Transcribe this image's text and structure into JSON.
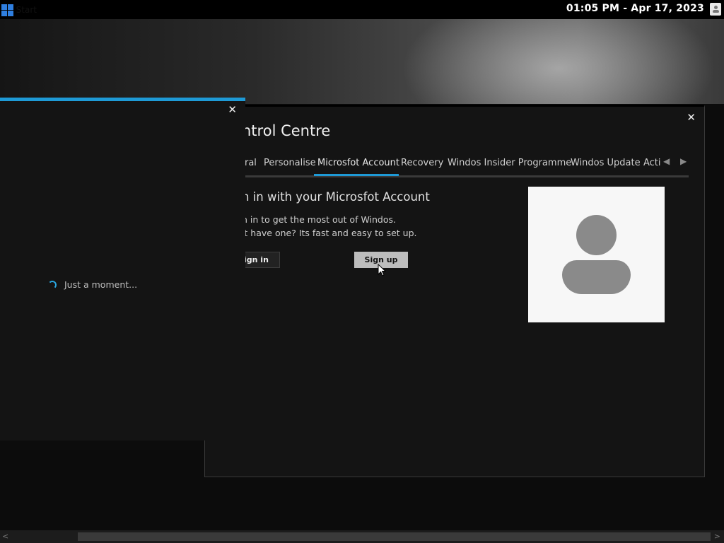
{
  "taskbar": {
    "start_label": "Start",
    "clock": "01:05 PM - Apr 17, 2023"
  },
  "control_centre": {
    "title": "ntrol Centre",
    "tabs": [
      {
        "label": "ral"
      },
      {
        "label": "Personalise"
      },
      {
        "label": "Microsfot Account",
        "active": true
      },
      {
        "label": "Recovery"
      },
      {
        "label": "Windos Insider Programme"
      },
      {
        "label": "Windos Update"
      },
      {
        "label": "Acti"
      }
    ],
    "heading": "n in with your Microsfot Account",
    "line1": "n in to get the most out of Windos.",
    "line2": "'t have one? Its fast and easy to set up.",
    "signin_label": "ign in",
    "signup_label": "Sign up"
  },
  "loading": {
    "text": "Just a moment..."
  },
  "colors": {
    "accent": "#1e9ad6",
    "background": "#141414",
    "start_logo": "#2f7fe0"
  },
  "icons": [
    "windows-logo-icon",
    "user-icon",
    "close-icon",
    "chevron-left-icon",
    "chevron-right-icon",
    "spinner-icon",
    "avatar-icon",
    "mouse-pointer-icon"
  ]
}
